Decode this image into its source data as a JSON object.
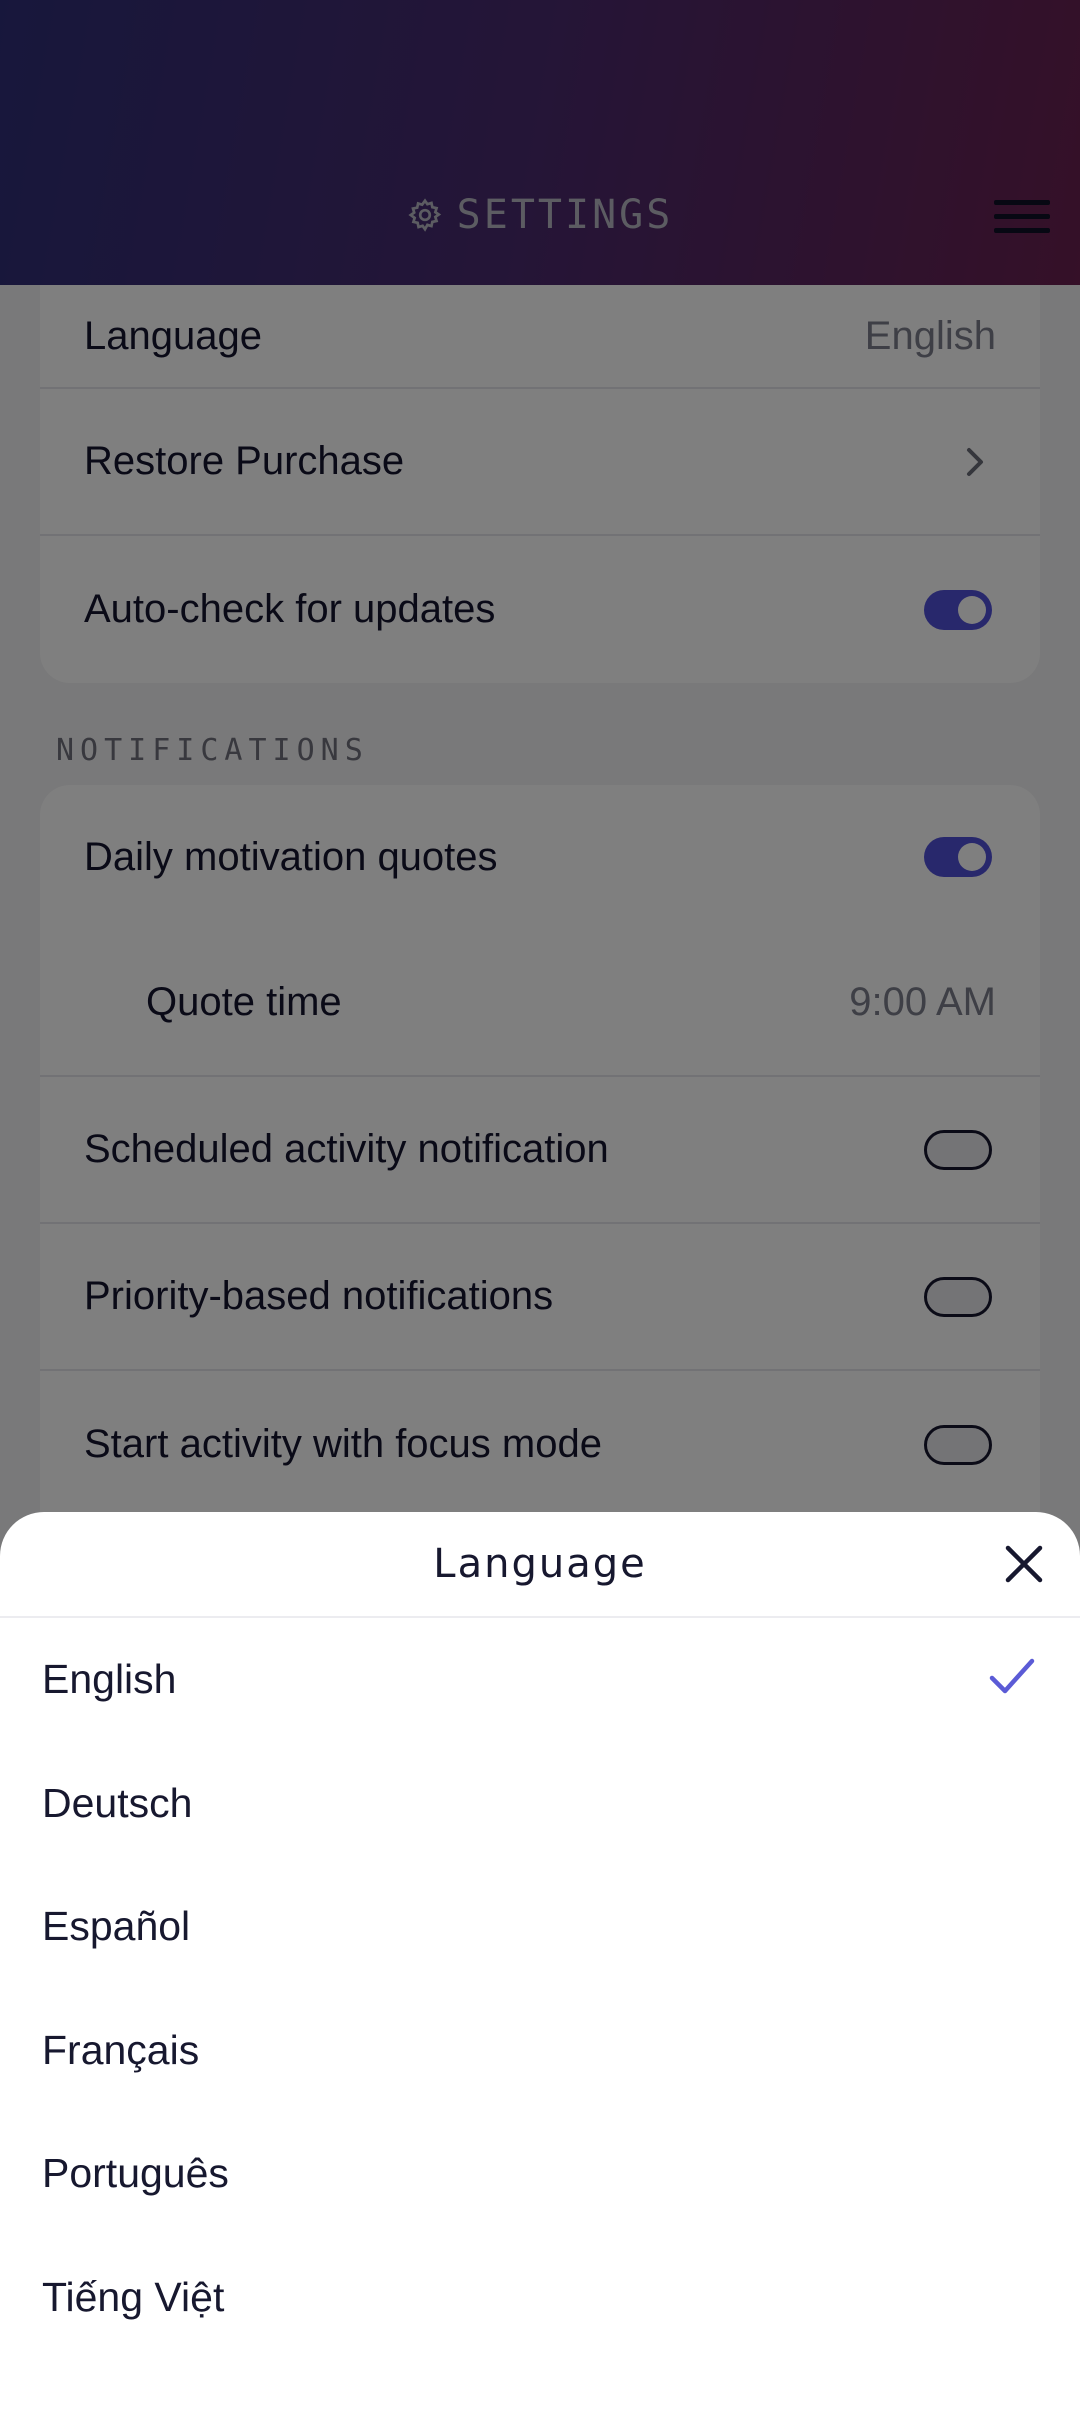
{
  "header": {
    "title": "SETTINGS",
    "gear_icon": "gear-icon",
    "menu_icon": "hamburger-menu-icon",
    "gradient": [
      "#2f2f78",
      "#6a2150"
    ]
  },
  "general": {
    "language_label": "Language",
    "language_value": "English",
    "restore_label": "Restore Purchase",
    "autocheck_label": "Auto-check for updates",
    "autocheck_on": true
  },
  "notifications": {
    "section_label": "NOTIFICATIONS",
    "daily_quotes_label": "Daily motivation quotes",
    "daily_quotes_on": true,
    "quote_time_label": "Quote time",
    "quote_time_value": "9:00 AM",
    "scheduled_label": "Scheduled activity notification",
    "scheduled_on": false,
    "priority_label": "Priority-based notifications",
    "priority_on": false,
    "focus_label": "Start activity with focus mode",
    "focus_on": false
  },
  "sheet": {
    "title": "Language",
    "selected": "English",
    "accent": "#5b5bd6",
    "languages": [
      "English",
      "Deutsch",
      "Español",
      "Français",
      "Português",
      "Tiếng Việt"
    ]
  }
}
